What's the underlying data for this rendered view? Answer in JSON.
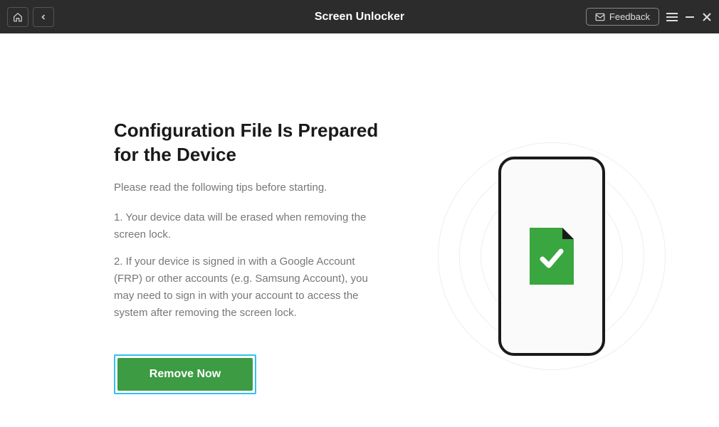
{
  "titlebar": {
    "title": "Screen Unlocker",
    "feedback_label": "Feedback"
  },
  "main": {
    "heading": "Configuration File Is Prepared for the Device",
    "subtext": "Please read the following tips before starting.",
    "tip1": "1. Your device data will be erased when removing the screen lock.",
    "tip2": "2. If your device is signed in with a Google Account (FRP) or other accounts (e.g. Samsung Account), you may need to sign in with your account to access the system after removing the screen lock.",
    "action_label": "Remove Now"
  },
  "colors": {
    "accent": "#3c9b43",
    "highlight": "#33c0f0",
    "titlebar": "#2c2c2c"
  }
}
